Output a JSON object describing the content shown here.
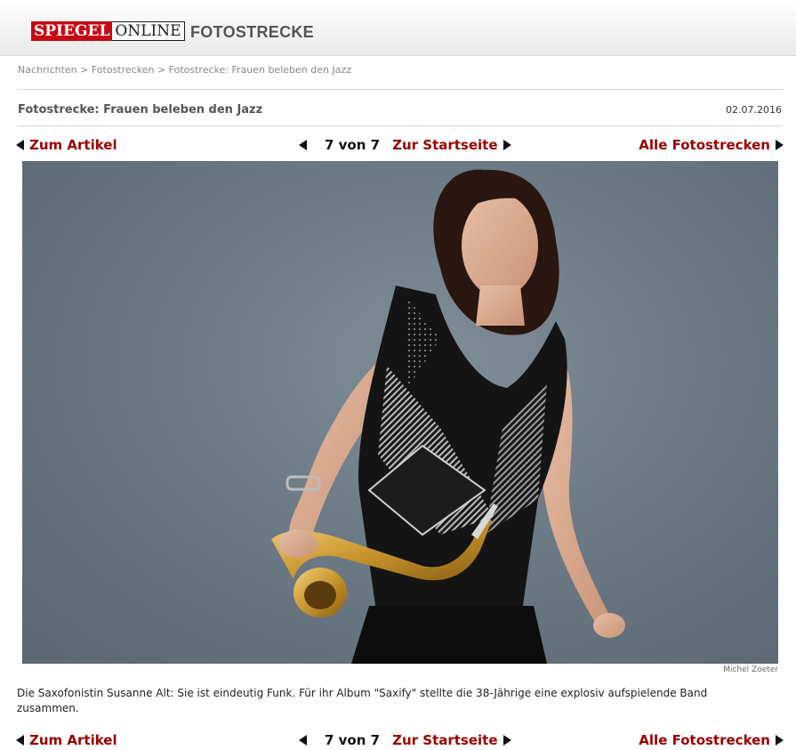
{
  "header": {
    "logo_part1": "SPIEGEL",
    "logo_part2": "ONLINE",
    "section_title": "FOTOSTRECKE"
  },
  "breadcrumb": {
    "items": [
      "Nachrichten",
      "Fotostrecken",
      "Fotostrecke: Frauen beleben den Jazz"
    ],
    "separator": ">"
  },
  "page": {
    "title": "Fotostrecke: Frauen beleben den Jazz",
    "date": "02.07.2016"
  },
  "nav": {
    "back_label": "Zum Artikel",
    "counter": "7 von 7",
    "home_label": "Zur Startseite",
    "all_label": "Alle Fotostrecken"
  },
  "photo": {
    "credit": "Michel Zoeter",
    "caption": "Die Saxofonistin Susanne Alt: Sie ist eindeutig Funk. Für ihr Album \"Saxify\" stellte die 38-Jährige eine explosiv aufspielende Band zusammen."
  },
  "colors": {
    "brand_red": "#c80813",
    "link_red": "#990000",
    "backdrop": "#6c7a85"
  }
}
